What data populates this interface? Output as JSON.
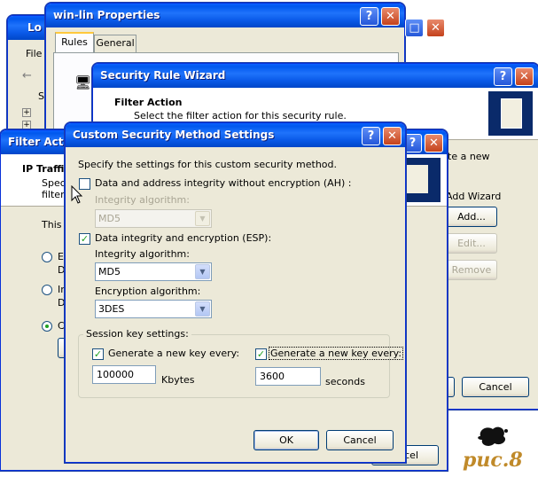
{
  "win_lin": {
    "title": "win-lin Properties",
    "tabs": [
      "Rules",
      "General"
    ]
  },
  "local": {
    "title": "Lo",
    "menu_file": "File",
    "tree_item": "Se"
  },
  "filter_action": {
    "title": "Filter Actio",
    "heading": "IP Traffic",
    "sub1": "Speci",
    "sub2": "filter a",
    "body": "This fi",
    "radio1_a": "E",
    "radio1_b": "D",
    "radio2_a": "In",
    "radio2_b": "D",
    "radio3_a": "Cu"
  },
  "wizard": {
    "title": "Security Rule Wizard",
    "heading": "Filter Action",
    "subheading": "Select the filter action for this security rule.",
    "right_text": "te a new",
    "add_wizard": "Add Wizard",
    "add_btn": "Add...",
    "edit_btn": "Edit...",
    "remove_btn": "Remove",
    "cancel_btn": "Cancel",
    "ncel_partial": "ncel"
  },
  "dialog": {
    "title": "Custom Security Method Settings",
    "instructions": "Specify the settings for this custom security method.",
    "ah_label": "Data and address integrity without encryption (AH) :",
    "ah_checked": false,
    "ah_integrity_label": "Integrity algorithm:",
    "ah_integrity_value": "MD5",
    "esp_label": "Data integrity and encryption (ESP):",
    "esp_checked": true,
    "esp_integrity_label": "Integrity algorithm:",
    "esp_integrity_value": "MD5",
    "encryption_label": "Encryption algorithm:",
    "encryption_value": "3DES",
    "session_group": "Session key settings:",
    "kb_check_label": "Generate a new key every:",
    "kb_value": "100000",
    "kb_unit": "Kbytes",
    "sec_check_label": "Generate a new key every:",
    "sec_value": "3600",
    "sec_unit": "seconds",
    "ok": "OK",
    "cancel": "Cancel"
  },
  "watermark": "puc.8",
  "colors": {
    "titlebar": "#0058ee",
    "face": "#ece9d8",
    "close": "#c4421c",
    "watermark": "#c08a2a"
  }
}
